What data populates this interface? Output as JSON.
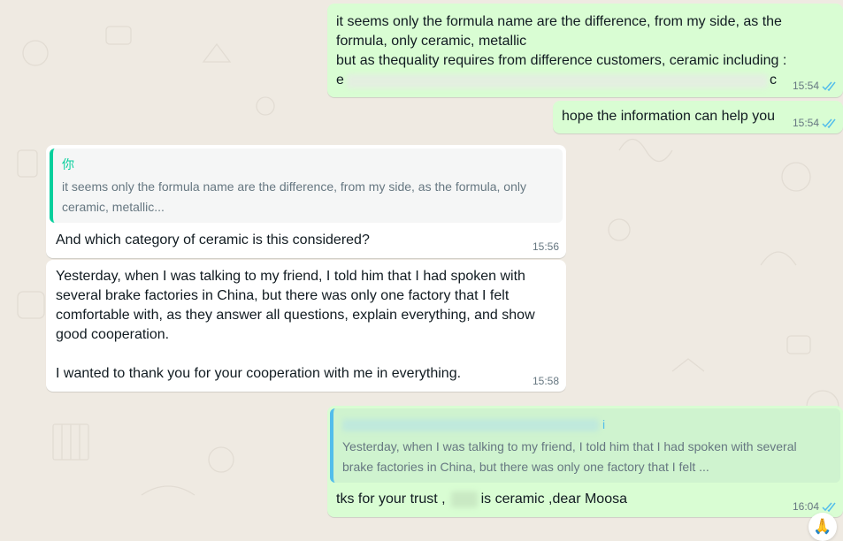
{
  "colors": {
    "outgoing_bubble": "#d9fdd3",
    "incoming_bubble": "#ffffff",
    "quote_accent_incoming": "#06cf9c",
    "quote_accent_outgoing": "#53bdeb",
    "read_ticks": "#53bdeb",
    "wallpaper": "#efeae2"
  },
  "messages": [
    {
      "direction": "outgoing",
      "lines": [
        "it seems only the formula name are the difference, from my side, as the",
        "formula, only ceramic, metallic",
        "but as thequality requires from difference customers, ceramic including :",
        "e",
        "c"
      ],
      "time": "15:54",
      "status": "read-double-tick-icon"
    },
    {
      "direction": "outgoing",
      "text": "hope the information can help you",
      "time": "15:54",
      "status": "read-double-tick-icon"
    },
    {
      "direction": "incoming",
      "quote": {
        "author": "你",
        "text": "it seems only the formula name are the difference, from my side, as the formula, only ceramic, metallic..."
      },
      "text": "And which category of ceramic is this considered?",
      "time": "15:56"
    },
    {
      "direction": "incoming",
      "text": "Yesterday, when I was talking to my friend, I told him that I had spoken with several brake factories in China, but there was only one factory that I felt comfortable with, as they answer all questions, explain everything, and show good cooperation.\n\nI wanted to thank you for your cooperation with me in everything.",
      "time": "15:58"
    },
    {
      "direction": "outgoing",
      "quote": {
        "author": "i",
        "text": "Yesterday, when I was talking to my friend, I told him that I had spoken with several brake factories in China, but there was only one factory that I felt ..."
      },
      "text_before": "tks for your trust ,",
      "text_after": "is ceramic ,dear Moosa",
      "time": "16:04",
      "status": "read-double-tick-icon"
    }
  ],
  "reaction_button": {
    "emoji": "🙏",
    "icon": "folded-hands-icon"
  }
}
